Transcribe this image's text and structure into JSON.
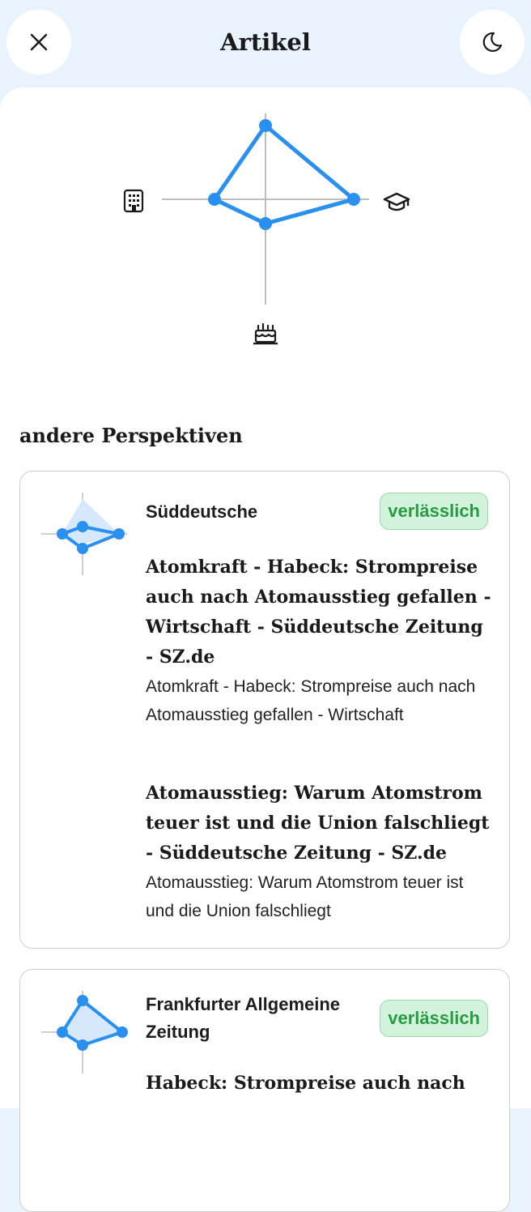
{
  "header": {
    "title": "Artikel",
    "close_icon": "close-icon",
    "theme_icon": "moon-icon"
  },
  "radar": {
    "axes": [
      "building-icon",
      "graduation-cap-icon",
      "birthday-cake-icon"
    ],
    "line_color": "#2a90f0"
  },
  "section": {
    "title": "andere Perspektiven"
  },
  "cards": [
    {
      "source": "Süddeutsche",
      "badge": "verlässlich",
      "articles": [
        {
          "title": "Atomkraft - Habeck: Strompreise auch nach Atomausstieg gefallen - Wirtschaft - Süddeutsche Zeitung - SZ.de",
          "subtitle": "Atomkraft - Habeck: Strompreise auch nach Atomausstieg gefallen - Wirtschaft"
        },
        {
          "title": "Atomausstieg: Warum Atomstrom teuer ist und die Union falschliegt - Süddeutsche Zeitung - SZ.de",
          "subtitle": "Atomausstieg: Warum Atomstrom teuer ist und die Union falschliegt"
        }
      ]
    },
    {
      "source": "Frankfurter Allgemeine Zeitung",
      "badge": "verlässlich",
      "articles": [
        {
          "title": "Habeck: Strompreise auch nach"
        }
      ]
    }
  ],
  "colors": {
    "accent": "#2a90f0",
    "badge_bg": "#d4f3dc",
    "badge_text": "#279a43",
    "header_bg": "#e8f3fd"
  }
}
